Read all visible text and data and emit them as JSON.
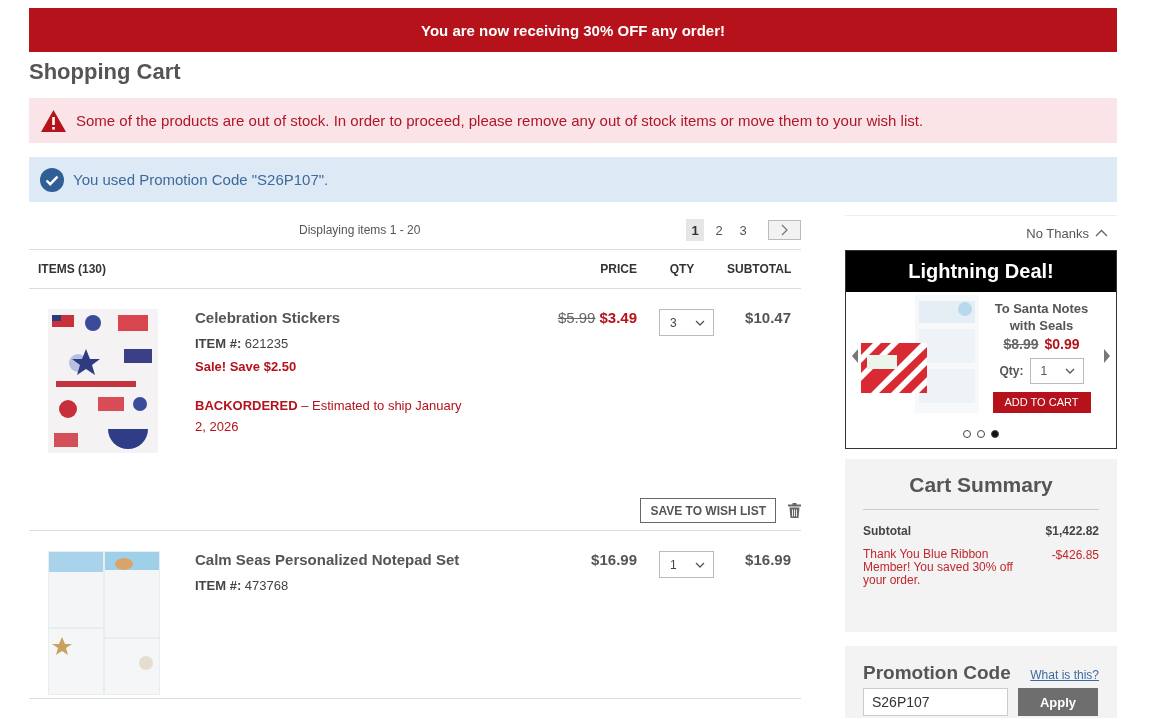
{
  "banner": {
    "text": "You are now receiving 30% OFF any order!"
  },
  "page_title": "Shopping Cart",
  "alerts": [
    {
      "kind": "error",
      "text": "Some of the products are out of stock. In order to proceed, please remove any out of stock items or move them to your wish list."
    },
    {
      "kind": "success",
      "text": "You used Promotion Code \"S26P107\"."
    }
  ],
  "pagination": {
    "summary": "Displaying items 1 - 20",
    "pages": [
      {
        "label": "1",
        "selected": true
      },
      {
        "label": "2",
        "selected": false
      },
      {
        "label": "3",
        "selected": false
      }
    ]
  },
  "table": {
    "columns": [
      "ITEMS (130)",
      "PRICE",
      "QTY",
      "SUBTOTAL"
    ],
    "rows": [
      {
        "kind": "stickers",
        "name": "Celebration Stickers",
        "item_number": "**ITEM #:** 621235",
        "original_price": "$5.99",
        "price": "$3.49",
        "sale_note": "Sale! Save $2.50",
        "stock_note": "**BACKORDERED** – Estimated to ship January 2, 2026",
        "qty": "3",
        "subtotal": "$10.47",
        "save_button": "SAVE TO WISH LIST"
      },
      {
        "kind": "notepad",
        "name": "Calm Seas Personalized Notepad Set",
        "item_number": "**ITEM #:** 473768",
        "price": "$16.99",
        "qty": "1",
        "subtotal": "$16.99"
      }
    ]
  },
  "deal": {
    "dismiss": "No Thanks",
    "title": "Lightning Deal!",
    "product": "To Santa Notes with Seals",
    "original_price": "$8.99",
    "price": "$0.99",
    "qty_label": "Qty:",
    "qty": "1",
    "button": "ADD TO CART",
    "slides": [
      {
        "selected": false
      },
      {
        "selected": false
      },
      {
        "selected": true
      }
    ]
  },
  "summary": {
    "title": "Cart Summary",
    "lines": [
      {
        "kind": "subtotal",
        "label": "Subtotal",
        "amount": "$1,422.82"
      },
      {
        "kind": "discount",
        "label": "Thank You Blue Ribbon Member! You saved 30% off your order.",
        "amount": "-$426.85"
      }
    ]
  },
  "promotion": {
    "title": "Promotion Code",
    "help_link": "What is this?",
    "value": "S26P107",
    "button": "Apply"
  }
}
